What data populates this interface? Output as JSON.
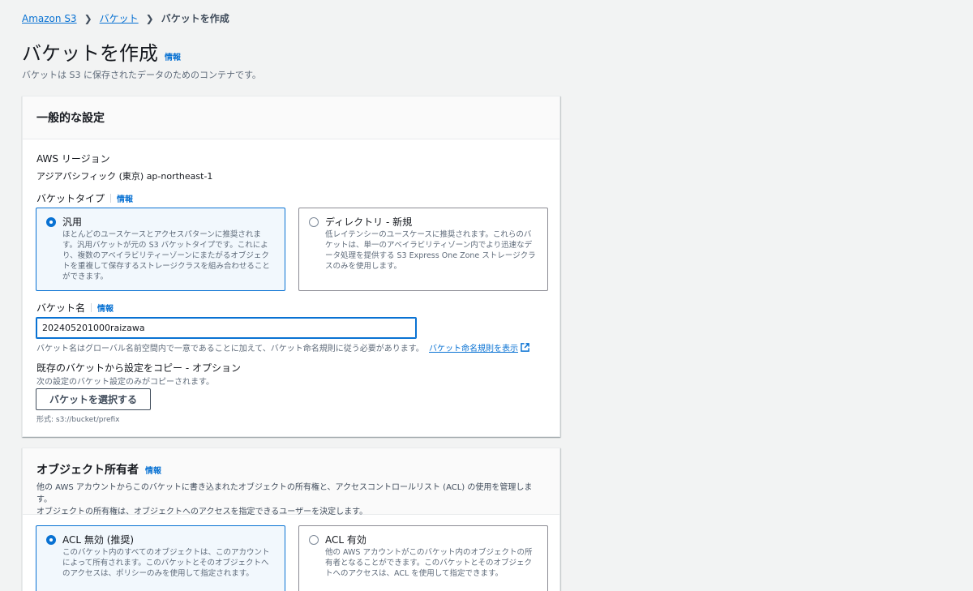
{
  "breadcrumb": {
    "items": [
      "Amazon S3",
      "バケット",
      "バケットを作成"
    ]
  },
  "page": {
    "title": "バケットを作成",
    "info": "情報",
    "description": "バケットは S3 に保存されたデータのためのコンテナです。"
  },
  "general": {
    "title": "一般的な設定",
    "region_label": "AWS リージョン",
    "region_value": "アジアパシフィック (東京) ap-northeast-1",
    "bucket_type_label": "バケットタイプ",
    "bucket_type_info": "情報",
    "types": [
      {
        "title": "汎用",
        "selected": true,
        "description": "ほとんどのユースケースとアクセスパターンに推奨されます。汎用バケットが元の S3 バケットタイプです。これにより、複数のアベイラビリティーゾーンにまたがるオブジェクトを重複して保存するストレージクラスを組み合わせることができます。"
      },
      {
        "title": "ディレクトリ - 新規",
        "selected": false,
        "description": "低レイテンシーのユースケースに推奨されます。これらのバケットは、単一のアベイラビリティゾーン内でより迅速なデータ処理を提供する S3 Express One Zone ストレージクラスのみを使用します。"
      }
    ],
    "bucket_name_label": "バケット名",
    "bucket_name_info": "情報",
    "bucket_name_value": "202405201000raizawa",
    "bucket_name_hint": "バケット名はグローバル名前空間内で一意であることに加えて、バケット命名規則に従う必要があります。",
    "bucket_name_rules_link": "バケット命名規則を表示",
    "copy_label": "既存のバケットから設定をコピー - オプション",
    "copy_desc": "次の設定のバケット設定のみがコピーされます。",
    "choose_bucket_button": "バケットを選択する",
    "format_hint": "形式: s3://bucket/prefix"
  },
  "ownership": {
    "title": "オブジェクト所有者",
    "info": "情報",
    "description_1": "他の AWS アカウントからこのバケットに書き込まれたオブジェクトの所有権と、アクセスコントロールリスト (ACL) の使用を管理します。",
    "description_2": "オブジェクトの所有権は、オブジェクトへのアクセスを指定できるユーザーを決定します。",
    "options": [
      {
        "title": "ACL 無効 (推奨)",
        "selected": true,
        "description": "このバケット内のすべてのオブジェクトは、このアカウントによって所有されます。このバケットとそのオブジェクトへのアクセスは、ポリシーのみを使用して指定されます。"
      },
      {
        "title": "ACL 有効",
        "selected": false,
        "description": "他の AWS アカウントがこのバケット内のオブジェクトの所有者となることができます。このバケットとそのオブジェクトへのアクセスは、ACL を使用して指定できます。"
      }
    ]
  },
  "colors": {
    "link": "#0972d3",
    "selected_tile_bg": "#f2f8fd",
    "page_bg": "#f2f3f3"
  }
}
